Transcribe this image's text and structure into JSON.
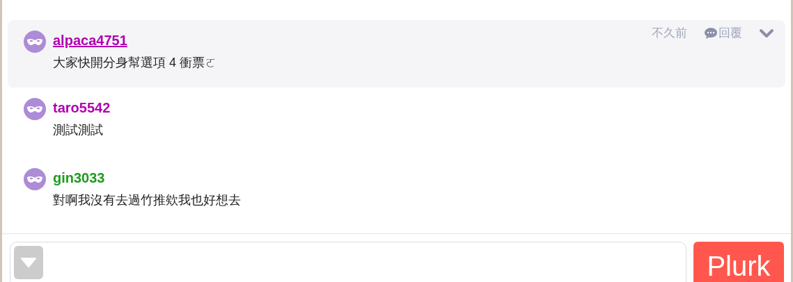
{
  "responses": [
    {
      "kind": "cut"
    },
    {
      "kind": "full",
      "user": "alpaca4751",
      "color": "#b000b0",
      "hovered": true,
      "text": "大家快開分身幫選項 4 衝票ㄛ",
      "time": "不久前",
      "reply": "回覆"
    },
    {
      "kind": "full",
      "user": "taro5542",
      "color": "#b000b0",
      "hovered": false,
      "text": "測試測試"
    },
    {
      "kind": "full",
      "user": "gin3033",
      "color": "#1f9b1f",
      "hovered": false,
      "text": "對啊我沒有去過竹推欸我也好想去"
    }
  ],
  "composer": {
    "button": "Plurk"
  }
}
